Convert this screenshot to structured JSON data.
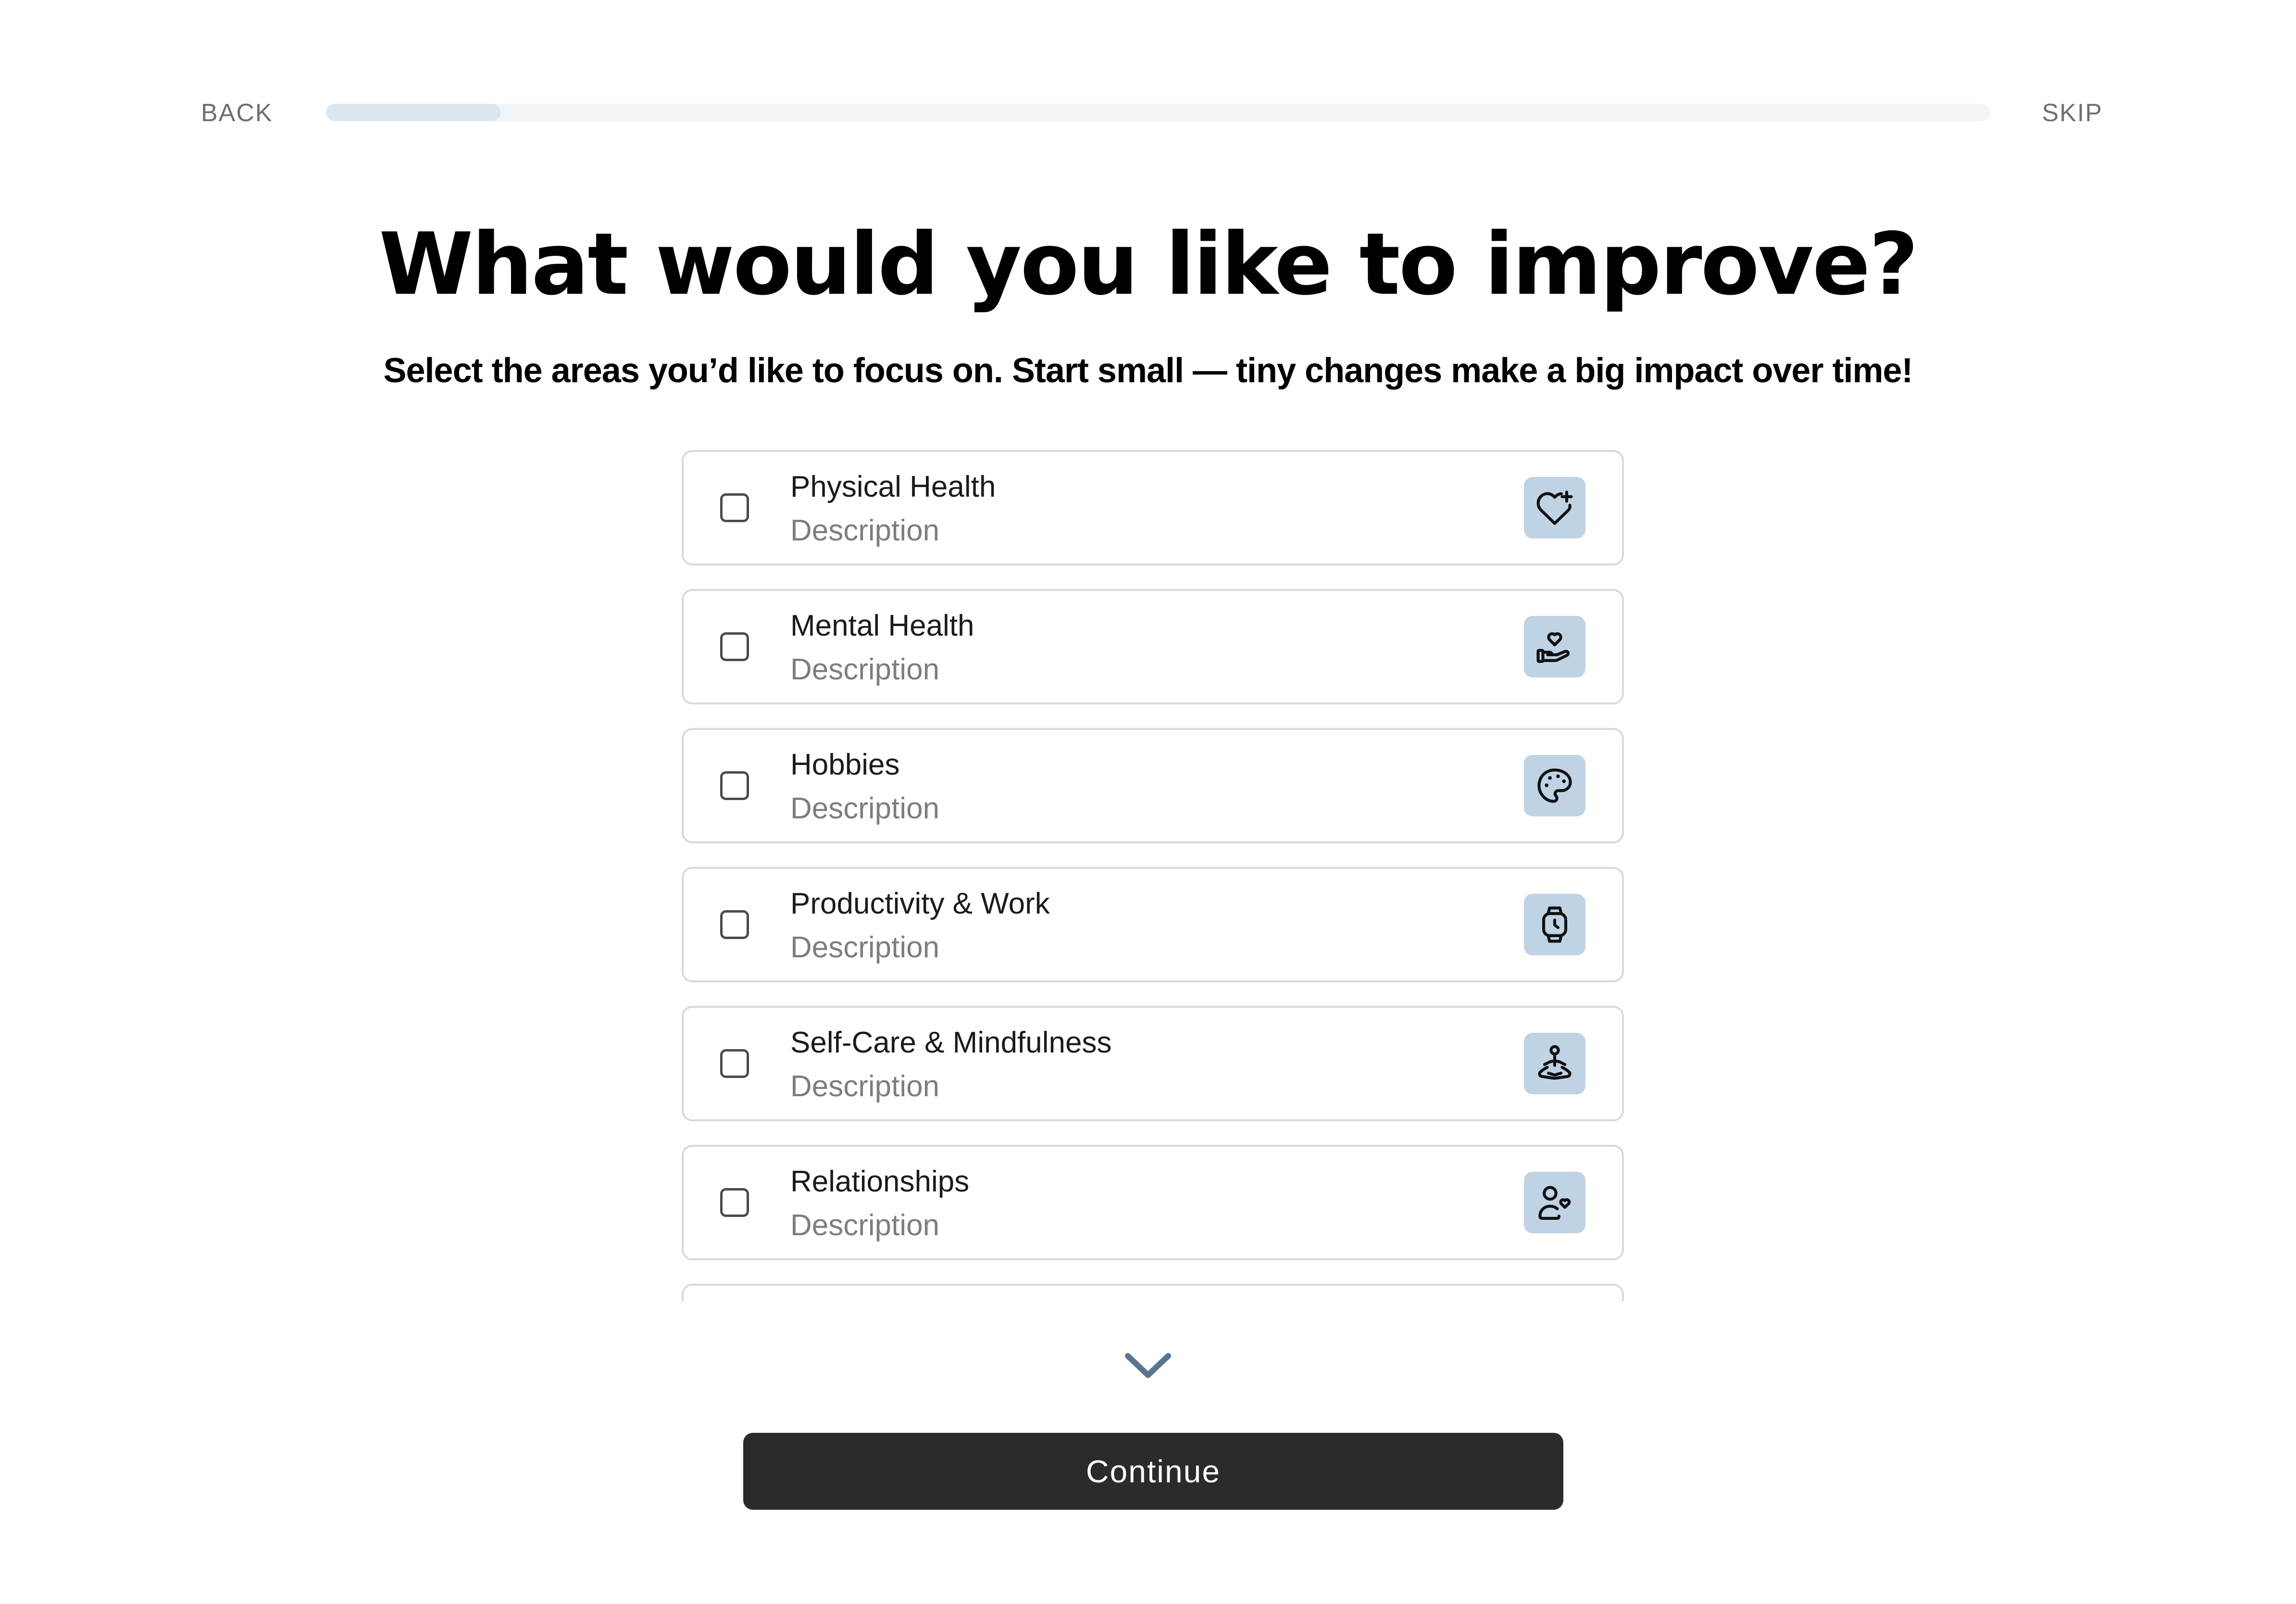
{
  "nav": {
    "back_label": "BACK",
    "skip_label": "SKIP",
    "progress": 0.105
  },
  "header": {
    "title": "What would you like to improve?",
    "subtitle": "Select the areas you’d like to focus on. Start small — tiny changes make a big impact over time!"
  },
  "options": [
    {
      "title": "Physical Health",
      "description": "Description",
      "icon": "heart-plus-icon",
      "checked": false
    },
    {
      "title": "Mental Health",
      "description": "Description",
      "icon": "hand-heart-icon",
      "checked": false
    },
    {
      "title": "Hobbies",
      "description": "Description",
      "icon": "palette-icon",
      "checked": false
    },
    {
      "title": "Productivity & Work",
      "description": "Description",
      "icon": "smartwatch-icon",
      "checked": false
    },
    {
      "title": "Self-Care & Mindfulness",
      "description": "Description",
      "icon": "meditation-icon",
      "checked": false
    },
    {
      "title": "Relationships",
      "description": "Description",
      "icon": "person-heart-icon",
      "checked": false
    }
  ],
  "actions": {
    "continue_label": "Continue"
  },
  "colors": {
    "primary_button": "#2b2b2b",
    "icon_background": "#bfd3e4",
    "progress_fill": "#dce6ee",
    "progress_track": "#f1f5f8",
    "chevron": "#5b7391"
  }
}
